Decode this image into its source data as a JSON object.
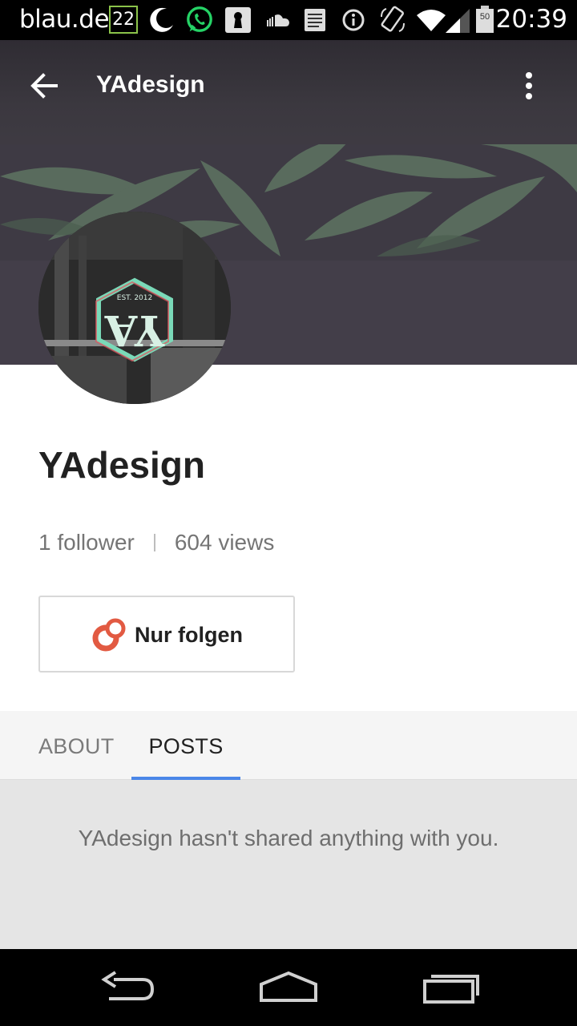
{
  "status_bar": {
    "carrier": "blau.de",
    "badge": "22",
    "time": "20:39",
    "battery": "50",
    "icons": [
      "moon-icon",
      "whatsapp-icon",
      "keyhole-icon",
      "soundcloud-icon",
      "notes-icon",
      "info-icon",
      "rotate-icon",
      "wifi-icon",
      "signal-icon",
      "battery-icon"
    ]
  },
  "app_bar": {
    "title": "YAdesign"
  },
  "avatar": {
    "logo_text": "YA",
    "est_text": "EST. 2012"
  },
  "profile": {
    "name": "YAdesign",
    "followers": "1 follower",
    "views": "604 views",
    "follow_label": "Nur folgen"
  },
  "tabs": [
    {
      "label": "ABOUT",
      "selected": false
    },
    {
      "label": "POSTS",
      "selected": true
    }
  ],
  "content": {
    "empty_message": "YAdesign hasn't shared anything with you."
  },
  "colors": {
    "accent": "#4a86e8",
    "follow_icon": "#e25a42",
    "badge_border": "#8bc34a",
    "whatsapp": "#25d366"
  }
}
